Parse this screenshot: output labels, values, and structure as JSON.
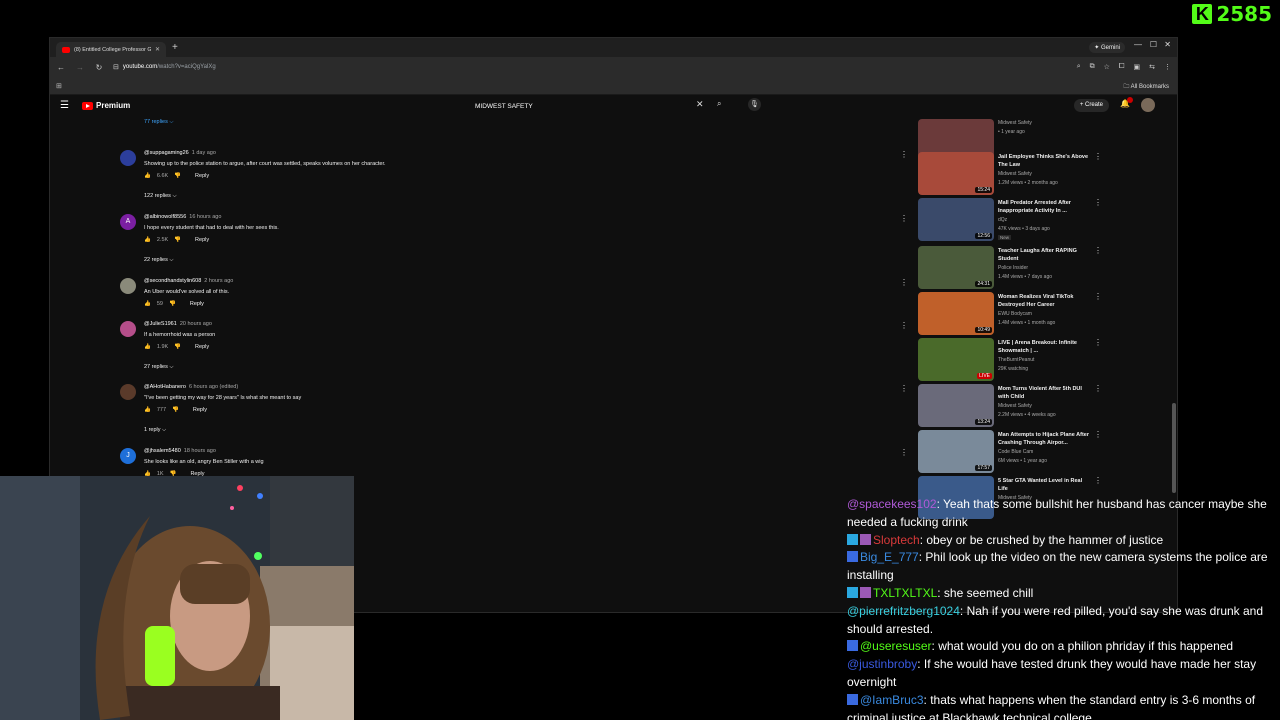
{
  "kick": {
    "count": "2585"
  },
  "browser": {
    "tab_title": "(8) Entitled College Professor G",
    "gemini_label": "Gemini",
    "url_host": "youtube.com",
    "url_path": "/watch?v=aciQgYalXg",
    "bookmarks_label": "All Bookmarks"
  },
  "youtube": {
    "brand": "Premium",
    "search_value": "MIDWEST SAFETY",
    "create_label": "Create",
    "top_replies": "77 replies",
    "comments": [
      {
        "handle": "@suppagaming26",
        "time": "1 day ago",
        "text": "Showing up to the police station to argue, after court was settled, speaks volumes on her character.",
        "likes": "6.6K",
        "reply": "Reply",
        "replies": "122 replies",
        "avatar_color": "#2c3e9c"
      },
      {
        "handle": "@albinowolf8556",
        "time": "16 hours ago",
        "text": "I hope every student that had to deal with her sees this.",
        "likes": "2.5K",
        "reply": "Reply",
        "replies": "22 replies",
        "avatar_color": "#7b1fa2",
        "letter": "A"
      },
      {
        "handle": "@secondhandstylin608",
        "time": "2 hours ago",
        "text": "An Uber would've solved all of this.",
        "likes": "59",
        "reply": "Reply",
        "replies": "",
        "avatar_color": "#8a8a7a"
      },
      {
        "handle": "@JulieS1961",
        "time": "20 hours ago",
        "text": "If a hemorrhoid was a person",
        "likes": "1.9K",
        "reply": "Reply",
        "replies": "27 replies",
        "avatar_color": "#b54e8a"
      },
      {
        "handle": "@AHotHabanero",
        "time": "6 hours ago (edited)",
        "text": "\"I've been getting my way for 28 years\" Is what she meant to say",
        "likes": "777",
        "reply": "Reply",
        "replies": "1 reply",
        "avatar_color": "#5a3a2a"
      },
      {
        "handle": "@jhsalem5480",
        "time": "18 hours ago",
        "text": "She looks like an old, angry Ben Stiller with a wig",
        "likes": "1K",
        "reply": "Reply",
        "replies": "",
        "avatar_color": "#1e6fd9",
        "letter": "J"
      }
    ],
    "sidebar": [
      {
        "title": "",
        "channel": "Midwest Safety",
        "meta": "• 1 year ago",
        "duration": "14:20",
        "thumb": "#6b3a3a"
      },
      {
        "title": "Jail Employee Thinks She's Above The Law",
        "channel": "Midwest Safety",
        "meta": "1.2M views • 2 months ago",
        "duration": "15:24",
        "thumb": "#a84a3a"
      },
      {
        "title": "Mall Predator Arrested After Inappropriate Activity In ...",
        "channel": "dQz",
        "meta": "47K views • 3 days ago",
        "duration": "12:56",
        "new": "New",
        "thumb": "#3a4a6a"
      },
      {
        "title": "Teacher Laughs After RAPING Student",
        "channel": "Police Insider",
        "meta": "1.4M views • 7 days ago",
        "duration": "24:31",
        "thumb": "#4a5a3a"
      },
      {
        "title": "Woman Realizes Viral TikTok Destroyed Her Career",
        "channel": "EWU Bodycam",
        "meta": "1.4M views • 1 month ago",
        "duration": "10:49",
        "thumb": "#c0602a"
      },
      {
        "title": "LIVE | Arena Breakout: Infinite Showmatch | ...",
        "channel": "TheBurntPeanut",
        "meta": "29K watching",
        "duration": "LIVE",
        "thumb": "#4a6a2a"
      },
      {
        "title": "Mom Turns Violent After 5th DUI with Child",
        "channel": "Midwest Safety",
        "meta": "2.2M views • 4 weeks ago",
        "duration": "13:24",
        "thumb": "#6a6a7a"
      },
      {
        "title": "Man Attempts to Hijack Plane After Crashing Through Airpor...",
        "channel": "Code Blue Cam",
        "meta": "6M views • 1 year ago",
        "duration": "17:57",
        "thumb": "#7a8a9a"
      },
      {
        "title": "5 Star GTA Wanted Level in Real Life",
        "channel": "Midwest Safety",
        "meta": "",
        "duration": "",
        "thumb": "#3a5a8a"
      }
    ]
  },
  "chat": [
    {
      "user": "@spacekees102",
      "text": ": Yeah thats some bullshit her husband has cancer maybe she needed a fucking drink",
      "color": "#b05ad8",
      "badges": []
    },
    {
      "user": "Sloptech",
      "text": ": obey or be crushed by the hammer of justice",
      "color": "#d93a3a",
      "badges": [
        "#2aa8e0",
        "#9b59b6"
      ]
    },
    {
      "user": "Big_E_777",
      "text": ": Phil look up the video on the new camera systems the police are installing",
      "color": "#3a8ae0",
      "badges": [
        "#3a6ae0"
      ]
    },
    {
      "user": "TXLTXLTXL",
      "text": ": she seemed chill",
      "color": "#53fc18",
      "badges": [
        "#2aa8e0",
        "#9b59b6"
      ]
    },
    {
      "user": "@pierrefritzberg1024",
      "text": ": Nah if you were red pilled, you'd say she was drunk and should arrested.",
      "color": "#3ad0e0",
      "badges": []
    },
    {
      "user": "@useresuser",
      "text": ": what would you do on a philion phriday if this happened",
      "color": "#53fc18",
      "badges": [
        "#3a6ae0"
      ]
    },
    {
      "user": "@justinbroby",
      "text": ": If she would have tested drunk they would have made her stay overnight",
      "color": "#3a5ae0",
      "badges": []
    },
    {
      "user": "@IamBruc3",
      "text": ": thats what happens when the standard entry is 3-6 months of criminal justice at Blackhawk technical college",
      "color": "#3a8ae0",
      "badges": [
        "#3a6ae0"
      ]
    }
  ]
}
